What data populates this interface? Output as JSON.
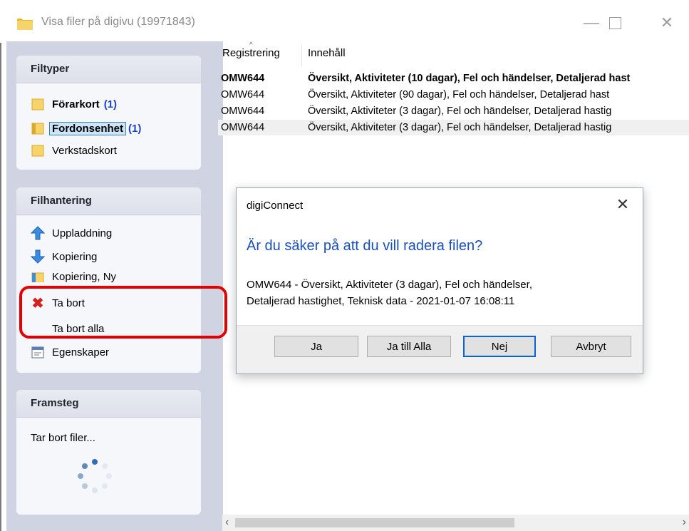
{
  "window": {
    "title": "Visa filer på digivu (19971843)"
  },
  "filetypes": {
    "header": "Filtyper",
    "items": [
      {
        "label": "Förarkort",
        "count": "(1)"
      },
      {
        "label": "Fordonsenhet",
        "count": "(1)"
      },
      {
        "label": "Verkstadskort",
        "count": ""
      }
    ]
  },
  "filehandling": {
    "header": "Filhantering",
    "items": [
      {
        "label": "Uppladdning",
        "icon": "arrow-up-icon"
      },
      {
        "label": "Kopiering",
        "icon": "arrow-down-icon"
      },
      {
        "label": "Kopiering, Ny",
        "icon": "folder-icon"
      },
      {
        "label": "Ta bort",
        "icon": "red-x-icon"
      },
      {
        "label": "Ta bort alla",
        "icon": ""
      },
      {
        "label": "Egenskaper",
        "icon": "properties-icon"
      }
    ]
  },
  "progress": {
    "header": "Framsteg",
    "status": "Tar bort filer..."
  },
  "table": {
    "columns": [
      "Registrering",
      "Innehåll"
    ],
    "rows": [
      {
        "reg": "OMW644",
        "content": "Översikt, Aktiviteter (10 dagar), Fel och händelser, Detaljerad hast"
      },
      {
        "reg": "OMW644",
        "content": "Översikt, Aktiviteter (90 dagar), Fel och händelser, Detaljerad hast"
      },
      {
        "reg": "OMW644",
        "content": "Översikt, Aktiviteter (3 dagar), Fel och händelser, Detaljerad hastig"
      },
      {
        "reg": "OMW644",
        "content": "Översikt, Aktiviteter (3 dagar), Fel och händelser, Detaljerad hastig"
      }
    ]
  },
  "dialog": {
    "title": "digiConnect",
    "question": "Är du säker på att du vill radera filen?",
    "message_line1": "OMW644 - Översikt, Aktiviteter (3 dagar), Fel och händelser,",
    "message_line2": "Detaljerad hastighet, Teknisk data - 2021-01-07 16:08:11",
    "buttons": {
      "yes": "Ja",
      "yes_all": "Ja till Alla",
      "no": "Nej",
      "cancel": "Avbryt"
    }
  },
  "colors": {
    "accent": "#1b4fb8",
    "highlight_box": "#e40000",
    "count": "#1b3fd6"
  }
}
